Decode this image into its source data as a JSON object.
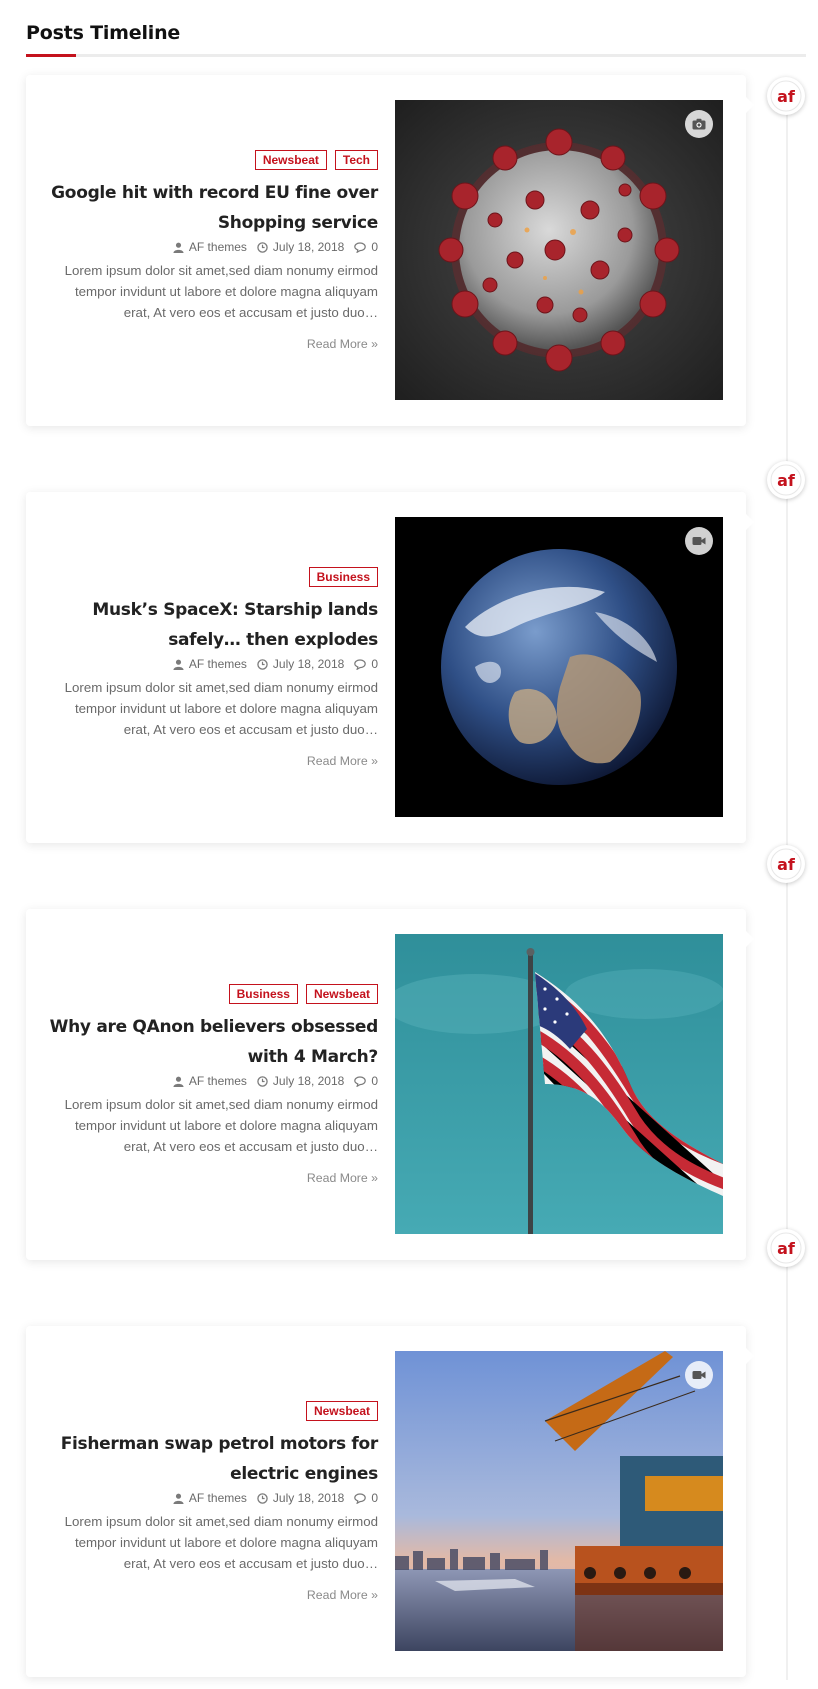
{
  "section": {
    "title": "Posts Timeline"
  },
  "colors": {
    "accent": "#c4121d"
  },
  "posts": [
    {
      "categories": [
        "Newsbeat",
        "Tech"
      ],
      "title": "Google hit with record EU fine over Shopping service",
      "author": "AF themes",
      "date": "July 18, 2018",
      "comments": "0",
      "excerpt": "Lorem ipsum dolor sit amet,sed diam nonumy eirmod tempor invidunt ut labore et dolore magna aliquyam erat, At vero eos et accusam et justo duo…",
      "read_more": "Read More »",
      "image": "coronavirus-image",
      "format_icon": "camera-icon"
    },
    {
      "categories": [
        "Business"
      ],
      "title": "Musk’s SpaceX: Starship lands safely… then explodes",
      "author": "AF themes",
      "date": "July 18, 2018",
      "comments": "0",
      "excerpt": "Lorem ipsum dolor sit amet,sed diam nonumy eirmod tempor invidunt ut labore et dolore magna aliquyam erat, At vero eos et accusam et justo duo…",
      "read_more": "Read More »",
      "image": "earth-image",
      "format_icon": "video-icon"
    },
    {
      "categories": [
        "Business",
        "Newsbeat"
      ],
      "title": "Why are QAnon believers obsessed with 4 March?",
      "author": "AF themes",
      "date": "July 18, 2018",
      "comments": "0",
      "excerpt": "Lorem ipsum dolor sit amet,sed diam nonumy eirmod tempor invidunt ut labore et dolore magna aliquyam erat, At vero eos et accusam et justo duo…",
      "read_more": "Read More »",
      "image": "us-flag-image",
      "format_icon": ""
    },
    {
      "categories": [
        "Newsbeat"
      ],
      "title": "Fisherman swap petrol motors for electric engines",
      "author": "AF themes",
      "date": "July 18, 2018",
      "comments": "0",
      "excerpt": "Lorem ipsum dolor sit amet,sed diam nonumy eirmod tempor invidunt ut labore et dolore magna aliquyam erat, At vero eos et accusam et justo duo…",
      "read_more": "Read More »",
      "image": "crane-ship-image",
      "format_icon": "video-icon"
    }
  ]
}
